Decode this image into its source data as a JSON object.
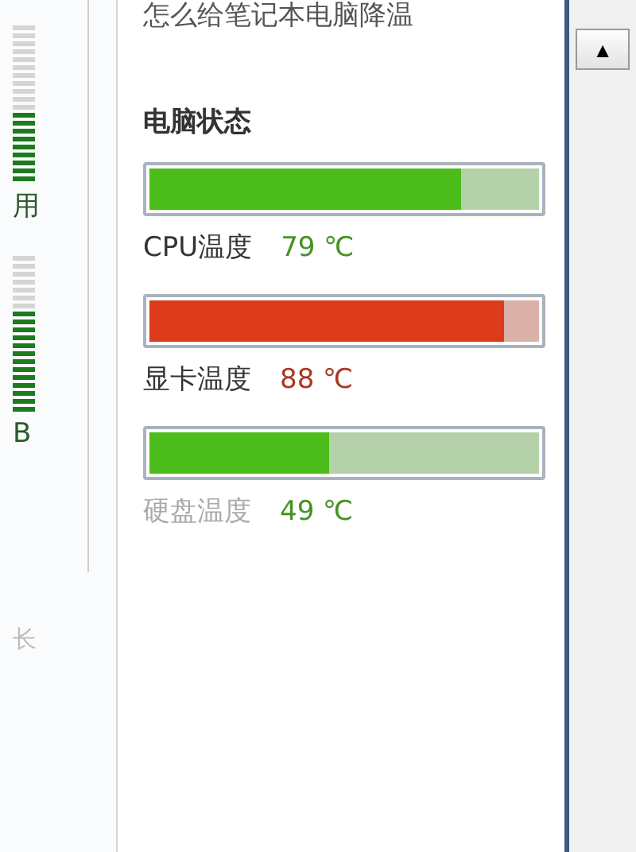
{
  "side_meters": [
    {
      "level": 0.45,
      "label": "用"
    },
    {
      "level": 0.65,
      "label": "B"
    }
  ],
  "side_note": "长",
  "panel": {
    "heading_cut": "怎么给笔记本电脑降温",
    "title": "电脑状态",
    "sensors": [
      {
        "name": "CPU温度",
        "reading": "79 ℃",
        "level": 0.8,
        "color": "#4cbc1a"
      },
      {
        "name": "显卡温度",
        "reading": "88 ℃",
        "level": 0.91,
        "color": "#dc3c1c"
      },
      {
        "name": "硬盘温度",
        "reading": "49 ℃",
        "level": 0.46,
        "color": "#4cbc1a"
      }
    ]
  },
  "scrollbar": {
    "up_arrow": "▲"
  }
}
